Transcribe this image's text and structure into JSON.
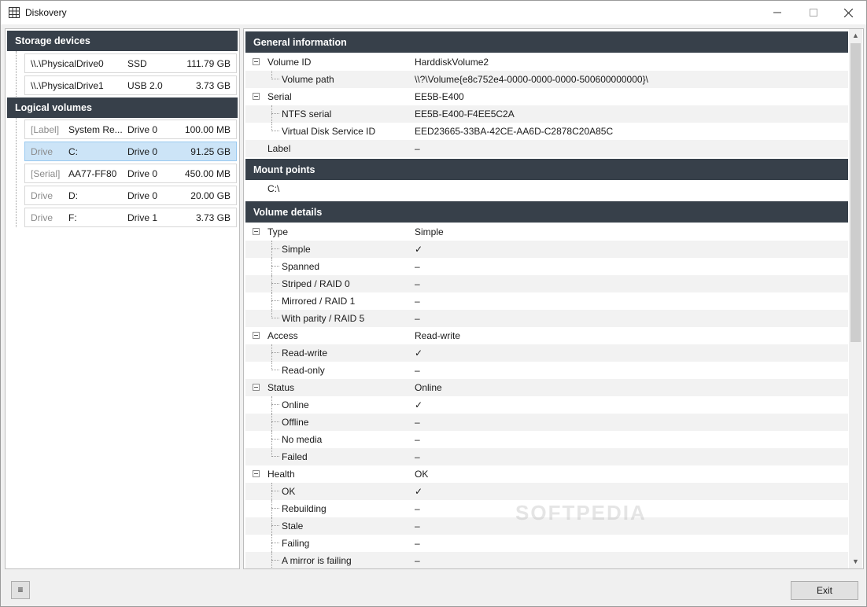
{
  "window": {
    "title": "Diskovery",
    "app_icon": "grid-icon"
  },
  "left": {
    "storage_header": "Storage devices",
    "storage_devices": [
      {
        "name": "\\\\.\\PhysicalDrive0",
        "bus": "SSD",
        "size": "111.79 GB"
      },
      {
        "name": "\\\\.\\PhysicalDrive1",
        "bus": "USB 2.0",
        "size": "3.73 GB"
      }
    ],
    "volumes_header": "Logical volumes",
    "volumes": [
      {
        "kind": "[Label]",
        "name": "System Re...",
        "drive": "Drive 0",
        "size": "100.00 MB",
        "selected": false
      },
      {
        "kind": "Drive",
        "name": "C:",
        "drive": "Drive 0",
        "size": "91.25 GB",
        "selected": true
      },
      {
        "kind": "[Serial]",
        "name": "AA77-FF80",
        "drive": "Drive 0",
        "size": "450.00 MB",
        "selected": false
      },
      {
        "kind": "Drive",
        "name": "D:",
        "drive": "Drive 0",
        "size": "20.00 GB",
        "selected": false
      },
      {
        "kind": "Drive",
        "name": "F:",
        "drive": "Drive 1",
        "size": "3.73 GB",
        "selected": false
      }
    ]
  },
  "right": {
    "general_header": "General information",
    "general": [
      {
        "label": "Volume ID",
        "value": "HarddiskVolume2",
        "level": 0,
        "group": true
      },
      {
        "label": "Volume path",
        "value": "\\\\?\\Volume{e8c752e4-0000-0000-0000-500600000000}\\",
        "level": 1,
        "last": true
      },
      {
        "label": "Serial",
        "value": "EE5B-E400",
        "level": 0,
        "group": true
      },
      {
        "label": "NTFS serial",
        "value": "EE5B-E400-F4EE5C2A",
        "level": 1
      },
      {
        "label": "Virtual Disk Service ID",
        "value": "EED23665-33BA-42CE-AA6D-C2878C20A85C",
        "level": 1,
        "last": true
      },
      {
        "label": "Label",
        "value": "–",
        "level": 0
      }
    ],
    "mount_header": "Mount points",
    "mount_points": [
      "C:\\"
    ],
    "details_header": "Volume details",
    "details": [
      {
        "label": "Type",
        "value": "Simple",
        "level": 0,
        "group": true
      },
      {
        "label": "Simple",
        "value": "✓",
        "level": 1
      },
      {
        "label": "Spanned",
        "value": "–",
        "level": 1
      },
      {
        "label": "Striped / RAID 0",
        "value": "–",
        "level": 1
      },
      {
        "label": "Mirrored / RAID 1",
        "value": "–",
        "level": 1
      },
      {
        "label": "With parity / RAID 5",
        "value": "–",
        "level": 1,
        "last": true
      },
      {
        "label": "Access",
        "value": "Read-write",
        "level": 0,
        "group": true
      },
      {
        "label": "Read-write",
        "value": "✓",
        "level": 1
      },
      {
        "label": "Read-only",
        "value": "–",
        "level": 1,
        "last": true
      },
      {
        "label": "Status",
        "value": "Online",
        "level": 0,
        "group": true
      },
      {
        "label": "Online",
        "value": "✓",
        "level": 1
      },
      {
        "label": "Offline",
        "value": "–",
        "level": 1
      },
      {
        "label": "No media",
        "value": "–",
        "level": 1
      },
      {
        "label": "Failed",
        "value": "–",
        "level": 1,
        "last": true
      },
      {
        "label": "Health",
        "value": "OK",
        "level": 0,
        "group": true
      },
      {
        "label": "OK",
        "value": "✓",
        "level": 1
      },
      {
        "label": "Rebuilding",
        "value": "–",
        "level": 1
      },
      {
        "label": "Stale",
        "value": "–",
        "level": 1
      },
      {
        "label": "Failing",
        "value": "–",
        "level": 1
      },
      {
        "label": "A mirror is failing",
        "value": "–",
        "level": 1
      }
    ],
    "watermark": "SOFTPEDIA"
  },
  "footer": {
    "menu_icon": "hamburger-icon",
    "menu_label": "≡",
    "exit_label": "Exit"
  },
  "colors": {
    "header_bg": "#37404a",
    "selected_bg": "#cce4f7",
    "alt_row": "#f2f2f2"
  }
}
